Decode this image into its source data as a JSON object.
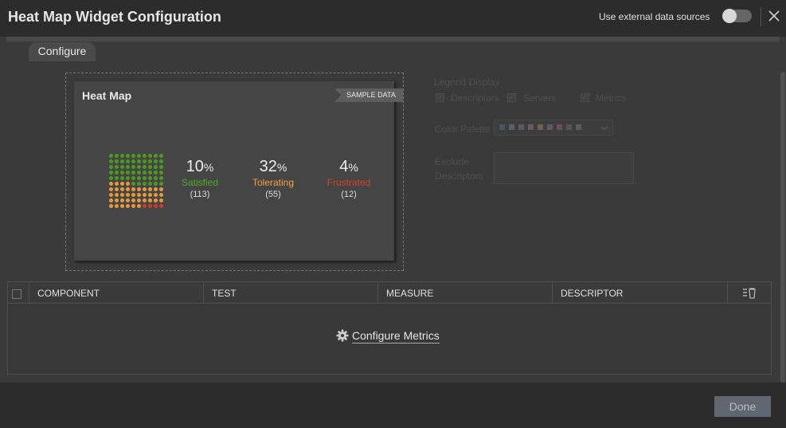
{
  "header": {
    "title": "Heat Map Widget Configuration",
    "external_label": "Use external data sources",
    "external_enabled": false
  },
  "tabs": [
    {
      "label": "Configure",
      "active": true
    }
  ],
  "preview": {
    "title": "Heat Map",
    "badge": "SAMPLE DATA",
    "stats": [
      {
        "value": "10",
        "unit": "%",
        "label": "Satisfied",
        "count": "(113)",
        "color": "#4caf24"
      },
      {
        "value": "32",
        "unit": "%",
        "label": "Tolerating",
        "count": "(55)",
        "color": "#f0a43a"
      },
      {
        "value": "4",
        "unit": "%",
        "label": "Frustrated",
        "count": "(12)",
        "color": "#d6402c"
      }
    ],
    "dot_colors": {
      "satisfied": "#4c9a1f",
      "tolerating": "#e89a3a",
      "frustrated": "#c8402c"
    }
  },
  "options": {
    "legend_display_label": "Legend Display",
    "legend_items": [
      {
        "label": "Descriptors",
        "checked": true
      },
      {
        "label": "Servers",
        "checked": true
      },
      {
        "label": "Metrics",
        "checked": true
      }
    ],
    "color_palette_label": "Color Palette",
    "palette_swatches": [
      "#4a5560",
      "#566068",
      "#5f5a62",
      "#6a5a5a",
      "#6a5f52",
      "#5a5a6a",
      "#6a5050",
      "#555",
      "#5c5c5c"
    ],
    "exclude_label_1": "Exclude",
    "exclude_label_2": "Descriptors"
  },
  "table": {
    "columns": [
      "COMPONENT",
      "TEST",
      "MEASURE",
      "DESCRIPTOR"
    ],
    "empty_action": "Configure Metrics"
  },
  "footer": {
    "done_label": "Done"
  }
}
